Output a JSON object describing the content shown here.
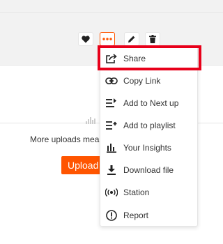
{
  "background": {
    "more_uploads_text": "More uploads mea",
    "upload_button_label": "Upload"
  },
  "track_actions": {
    "like_icon": "heart-icon",
    "more_icon": "more-dots-icon",
    "edit_icon": "pencil-icon",
    "delete_icon": "trash-icon"
  },
  "menu": {
    "items": [
      {
        "label": "Share",
        "icon": "share-icon"
      },
      {
        "label": "Copy Link",
        "icon": "link-icon"
      },
      {
        "label": "Add to Next up",
        "icon": "next-up-icon"
      },
      {
        "label": "Add to playlist",
        "icon": "add-playlist-icon"
      },
      {
        "label": "Your Insights",
        "icon": "insights-icon"
      },
      {
        "label": "Download file",
        "icon": "download-icon"
      },
      {
        "label": "Station",
        "icon": "station-icon"
      },
      {
        "label": "Report",
        "icon": "report-icon"
      }
    ]
  },
  "colors": {
    "accent": "#ff5500",
    "highlight": "#e8001a"
  }
}
